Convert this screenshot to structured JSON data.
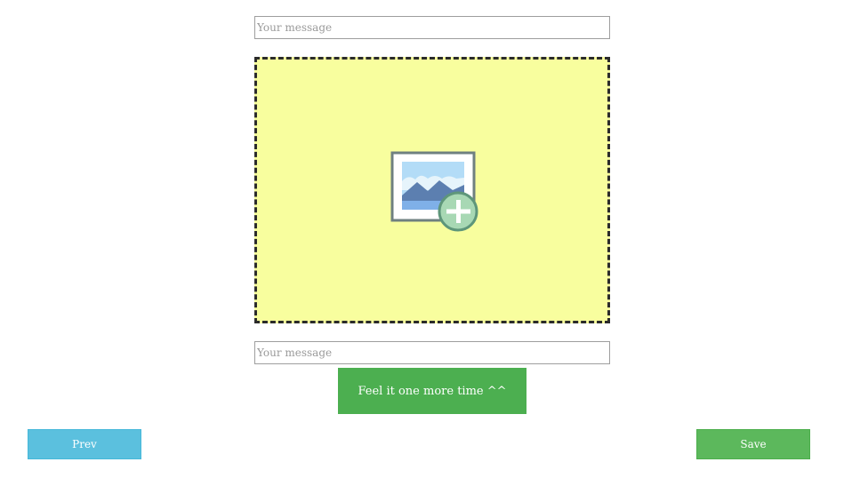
{
  "form": {
    "message_top_placeholder": "Your message",
    "message_bottom_placeholder": "Your message",
    "dropzone_icon": "add-image-icon",
    "feel_button_label": "Feel it one more time ^^"
  },
  "footer": {
    "prev_label": "Prev",
    "save_label": "Save"
  },
  "colors": {
    "dropzone_bg": "#f8fe9e",
    "feel_button": "#4caf50",
    "prev_button": "#5bc0de",
    "save_button": "#5cb85c"
  }
}
